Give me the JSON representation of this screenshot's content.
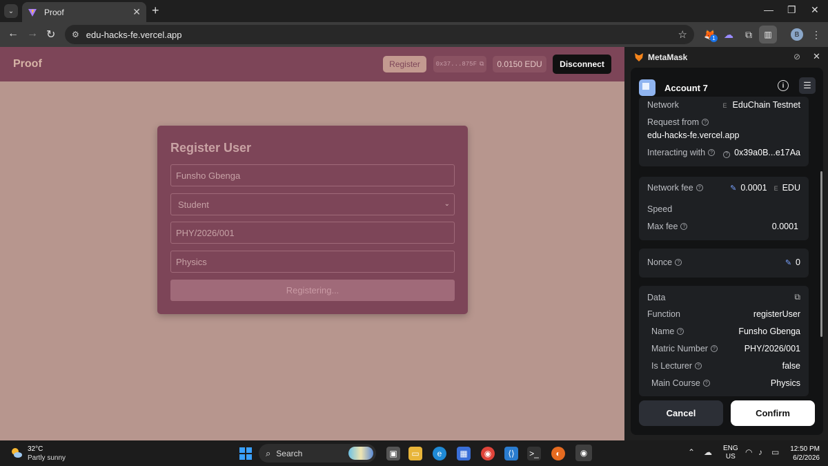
{
  "browser": {
    "tab_title": "Proof",
    "new_tab": "+",
    "url": "edu-hacks-fe.vercel.app",
    "extension_badge": "1",
    "profile_initial": "B"
  },
  "app": {
    "brand": "Proof",
    "header": {
      "register_label": "Register",
      "address": "0x37...875F",
      "balance": "0.0150 EDU",
      "disconnect_label": "Disconnect"
    },
    "form": {
      "title": "Register User",
      "name_value": "Funsho Gbenga",
      "role_value": "Student",
      "matric_value": "PHY/2026/001",
      "course_value": "Physics",
      "submit_label": "Registering..."
    }
  },
  "metamask": {
    "panel_title": "MetaMask",
    "account": "Account 7",
    "network_label": "Network",
    "network_icon_letter": "E",
    "network_value": "EduChain Testnet",
    "request_from_label": "Request from",
    "request_from_value": "edu-hacks-fe.vercel.app",
    "interacting_label": "Interacting with",
    "interacting_value": "0x39a0B...e17Aa",
    "network_fee_label": "Network fee",
    "network_fee_value": "0.0001",
    "network_fee_unit_icon": "E",
    "network_fee_unit": "EDU",
    "speed_label": "Speed",
    "max_fee_label": "Max fee",
    "max_fee_value": "0.0001",
    "nonce_label": "Nonce",
    "nonce_value": "0",
    "data_label": "Data",
    "function_label": "Function",
    "function_value": "registerUser",
    "params": [
      {
        "label": "Name",
        "value": "Funsho Gbenga"
      },
      {
        "label": "Matric Number",
        "value": "PHY/2026/001"
      },
      {
        "label": "Is Lecturer",
        "value": "false"
      },
      {
        "label": "Main Course",
        "value": "Physics"
      }
    ],
    "cancel_label": "Cancel",
    "confirm_label": "Confirm"
  },
  "taskbar": {
    "weather_temp": "32°C",
    "weather_desc": "Partly sunny",
    "search_label": "Search",
    "lang_line1": "ENG",
    "lang_line2": "US",
    "time": "12:50 PM",
    "date": "6/2/2026"
  }
}
